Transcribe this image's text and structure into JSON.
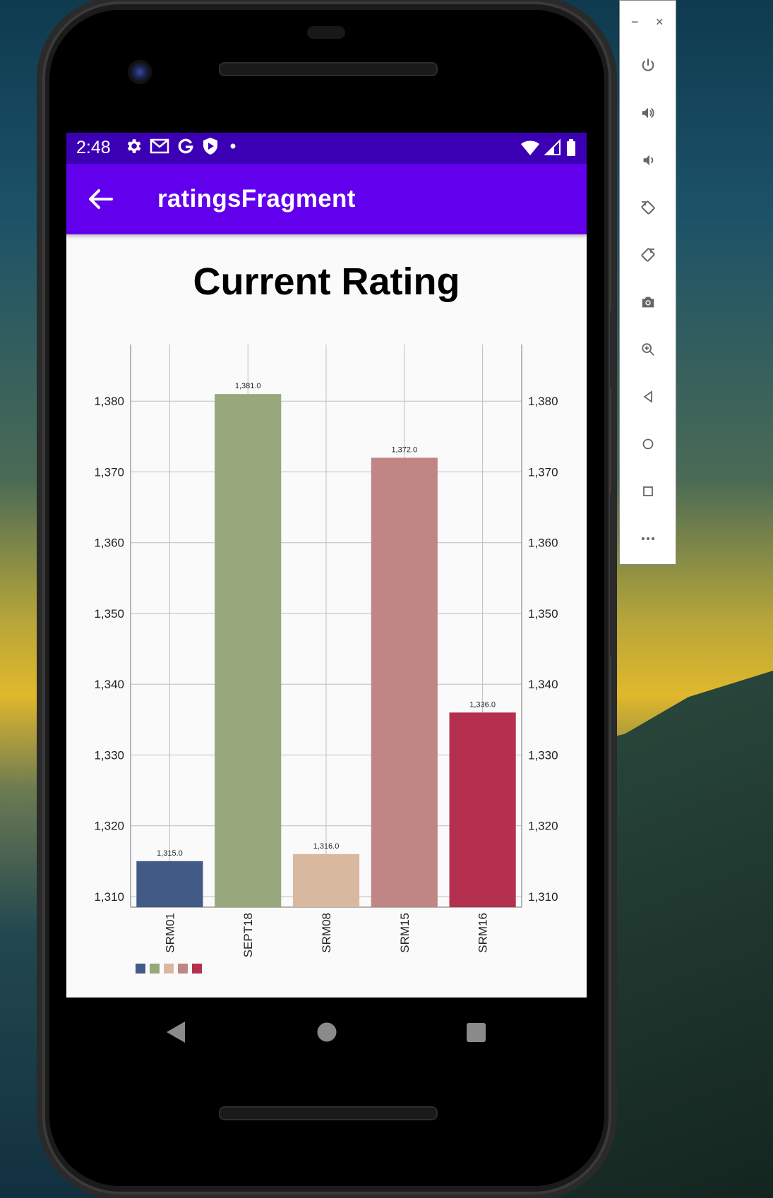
{
  "status_bar": {
    "time": "2:48",
    "left_icons": [
      "gear-icon",
      "gmail-icon",
      "google-g-icon",
      "shield-play-icon",
      "dot-icon"
    ],
    "right_icons": [
      "wifi-icon",
      "cell-signal-icon",
      "battery-icon"
    ],
    "color": "#3c00b4"
  },
  "app_bar": {
    "title": "ratingsFragment",
    "back_icon": "arrow-back-icon",
    "color": "#6200ee"
  },
  "chart_data": {
    "type": "bar",
    "title": "Current Rating",
    "categories": [
      "SRM01",
      "SEPT18",
      "SRM08",
      "SRM15",
      "SRM16"
    ],
    "values": [
      1315.0,
      1381.0,
      1316.0,
      1372.0,
      1336.0
    ],
    "value_labels": [
      "1,315.0",
      "1,381.0",
      "1,316.0",
      "1,372.0",
      "1,336.0"
    ],
    "colors": [
      "#425a86",
      "#98a77c",
      "#d9b8a0",
      "#c08685",
      "#b5304f"
    ],
    "ylim": [
      1308.5,
      1388
    ],
    "y_ticks": [
      1310,
      1320,
      1330,
      1340,
      1350,
      1360,
      1370,
      1380
    ],
    "y_tick_labels": [
      "1,310",
      "1,320",
      "1,330",
      "1,340",
      "1,350",
      "1,360",
      "1,370",
      "1,380"
    ],
    "axes": "left and right",
    "grid": true,
    "legend": "bottom-left, color swatches only"
  },
  "nav_bar": {
    "back": "nav-back-icon",
    "home": "nav-home-icon",
    "recents": "nav-recents-icon"
  },
  "emulator_panel": {
    "minimize": "−",
    "close": "×",
    "tools": [
      "power-icon",
      "volume-up-icon",
      "volume-down-icon",
      "rotate-left-icon",
      "rotate-right-icon",
      "camera-icon",
      "zoom-icon",
      "back-triangle-icon",
      "home-circle-icon",
      "overview-square-icon",
      "more-icon"
    ]
  }
}
